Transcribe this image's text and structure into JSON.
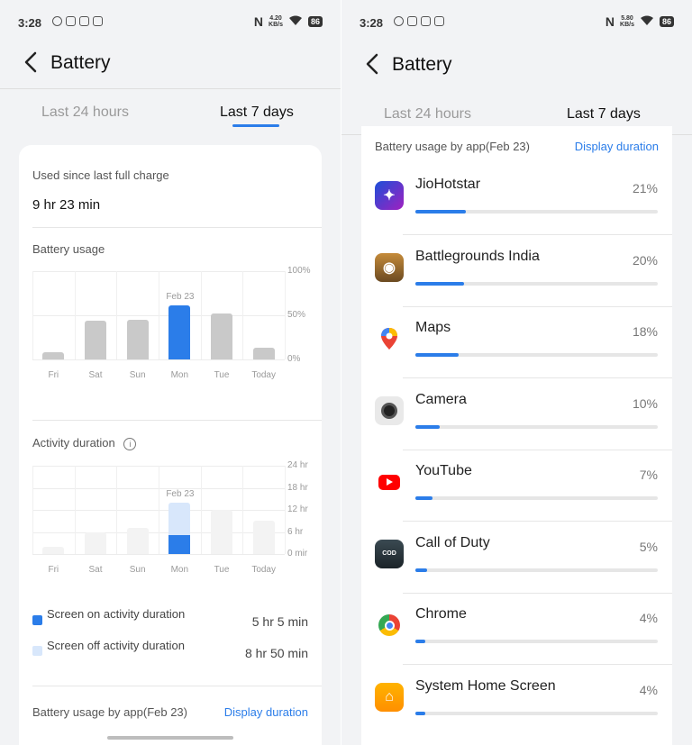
{
  "left": {
    "status": {
      "time": "3:28",
      "net_speed_top": "4.20",
      "net_speed_bottom": "KB/s",
      "battery": "86"
    },
    "title": "Battery",
    "tabs": [
      "Last 24 hours",
      "Last 7 days"
    ],
    "summary": {
      "label": "Used since last full charge",
      "value": "9 hr 23 min"
    },
    "battery_usage": {
      "title": "Battery usage",
      "yticks": [
        "100%",
        "50%",
        "0%"
      ],
      "days": [
        "Fri",
        "Sat",
        "Sun",
        "Mon",
        "Tue",
        "Today"
      ],
      "highlight_label": "Feb 23"
    },
    "activity": {
      "title": "Activity duration",
      "yticks": [
        "24 hr",
        "18 hr",
        "12 hr",
        "6 hr",
        "0 mir"
      ],
      "days": [
        "Fri",
        "Sat",
        "Sun",
        "Mon",
        "Tue",
        "Today"
      ],
      "highlight_label": "Feb 23",
      "legend": [
        {
          "label": "Screen on activity duration",
          "value": "5 hr 5 min",
          "color": "#2b7de9"
        },
        {
          "label": "Screen off activity duration",
          "value": "8 hr 50 min",
          "color": "#d8e7fb"
        }
      ]
    },
    "app_section": {
      "title": "Battery usage by app(Feb 23)",
      "link": "Display duration"
    }
  },
  "right": {
    "status": {
      "time": "3:28",
      "net_speed_top": "5.80",
      "net_speed_bottom": "KB/s",
      "battery": "86"
    },
    "title": "Battery",
    "tabs": [
      "Last 24 hours",
      "Last 7 days"
    ],
    "app_section": {
      "title": "Battery usage by app(Feb 23)",
      "link": "Display duration"
    },
    "apps": [
      {
        "name": "JioHotstar",
        "percent": "21%",
        "fraction": 0.21,
        "icon": "jiohotstar-icon"
      },
      {
        "name": "Battlegrounds India",
        "percent": "20%",
        "fraction": 0.2,
        "icon": "bgmi-icon"
      },
      {
        "name": "Maps",
        "percent": "18%",
        "fraction": 0.18,
        "icon": "maps-icon"
      },
      {
        "name": "Camera",
        "percent": "10%",
        "fraction": 0.1,
        "icon": "camera-icon"
      },
      {
        "name": "YouTube",
        "percent": "7%",
        "fraction": 0.07,
        "icon": "youtube-icon"
      },
      {
        "name": "Call of Duty",
        "percent": "5%",
        "fraction": 0.05,
        "icon": "call-of-duty-icon"
      },
      {
        "name": "Chrome",
        "percent": "4%",
        "fraction": 0.04,
        "icon": "chrome-icon"
      },
      {
        "name": "System Home Screen",
        "percent": "4%",
        "fraction": 0.04,
        "icon": "home-screen-icon"
      }
    ]
  },
  "chart_data": [
    {
      "type": "bar",
      "title": "Battery usage",
      "categories": [
        "Fri",
        "Sat",
        "Sun",
        "Mon",
        "Tue",
        "Today"
      ],
      "values": [
        8,
        44,
        45,
        61,
        52,
        13
      ],
      "ylim": [
        0,
        100
      ],
      "highlight": "Mon"
    },
    {
      "type": "bar",
      "title": "Activity duration",
      "categories": [
        "Fri",
        "Sat",
        "Sun",
        "Mon",
        "Tue",
        "Today"
      ],
      "series": [
        {
          "name": "Screen on activity duration",
          "values": [
            0,
            0,
            0,
            5.08,
            0,
            0
          ]
        },
        {
          "name": "Screen off activity duration",
          "values": [
            2,
            6,
            7,
            8.83,
            12,
            9
          ]
        }
      ],
      "ylim": [
        0,
        24
      ],
      "highlight": "Mon"
    }
  ],
  "colors": {
    "accent": "#2b7de9",
    "bar_grey": "#c9c9c9",
    "light_blue": "#d8e7fb"
  }
}
